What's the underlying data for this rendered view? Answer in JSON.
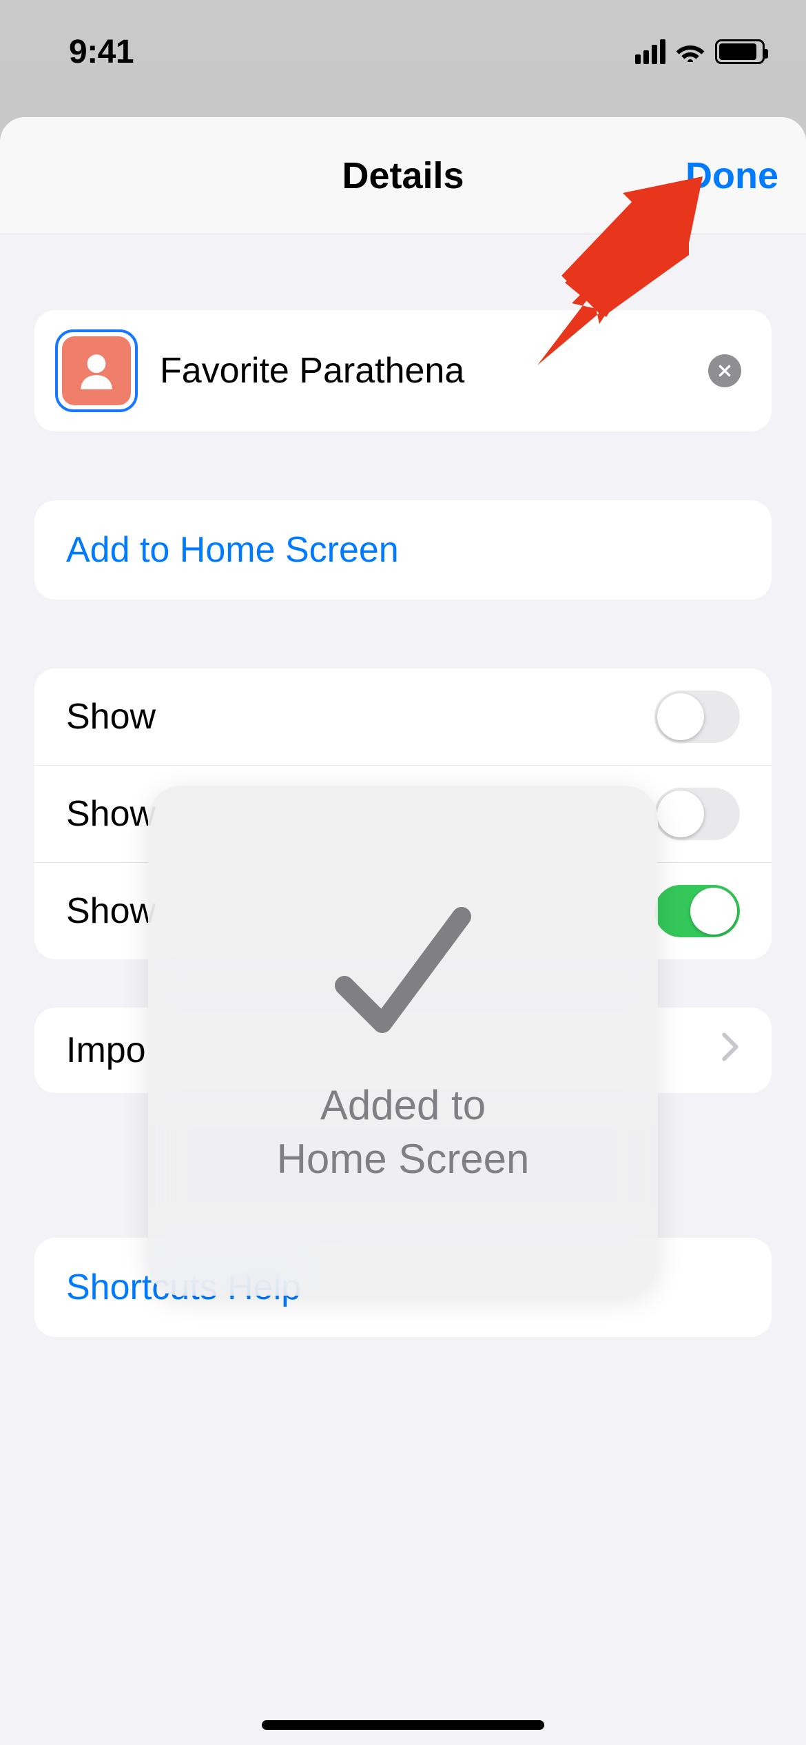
{
  "status": {
    "time": "9:41"
  },
  "sheet": {
    "title": "Details",
    "done_label": "Done"
  },
  "shortcut": {
    "name": "Favorite Parathena"
  },
  "actions": {
    "add_to_home": "Add to Home Screen",
    "import_questions": "Impo",
    "shortcuts_help": "Shortcuts Help"
  },
  "toggles": [
    {
      "label": "Show",
      "on": false
    },
    {
      "label": "Show",
      "on": false
    },
    {
      "label": "Show",
      "on": true
    }
  ],
  "hud": {
    "line1": "Added to",
    "line2": "Home Screen"
  },
  "colors": {
    "accent": "#007aff",
    "icon_bg": "#ef7e6a",
    "toggle_on": "#34c759",
    "annotation": "#e7361b"
  }
}
